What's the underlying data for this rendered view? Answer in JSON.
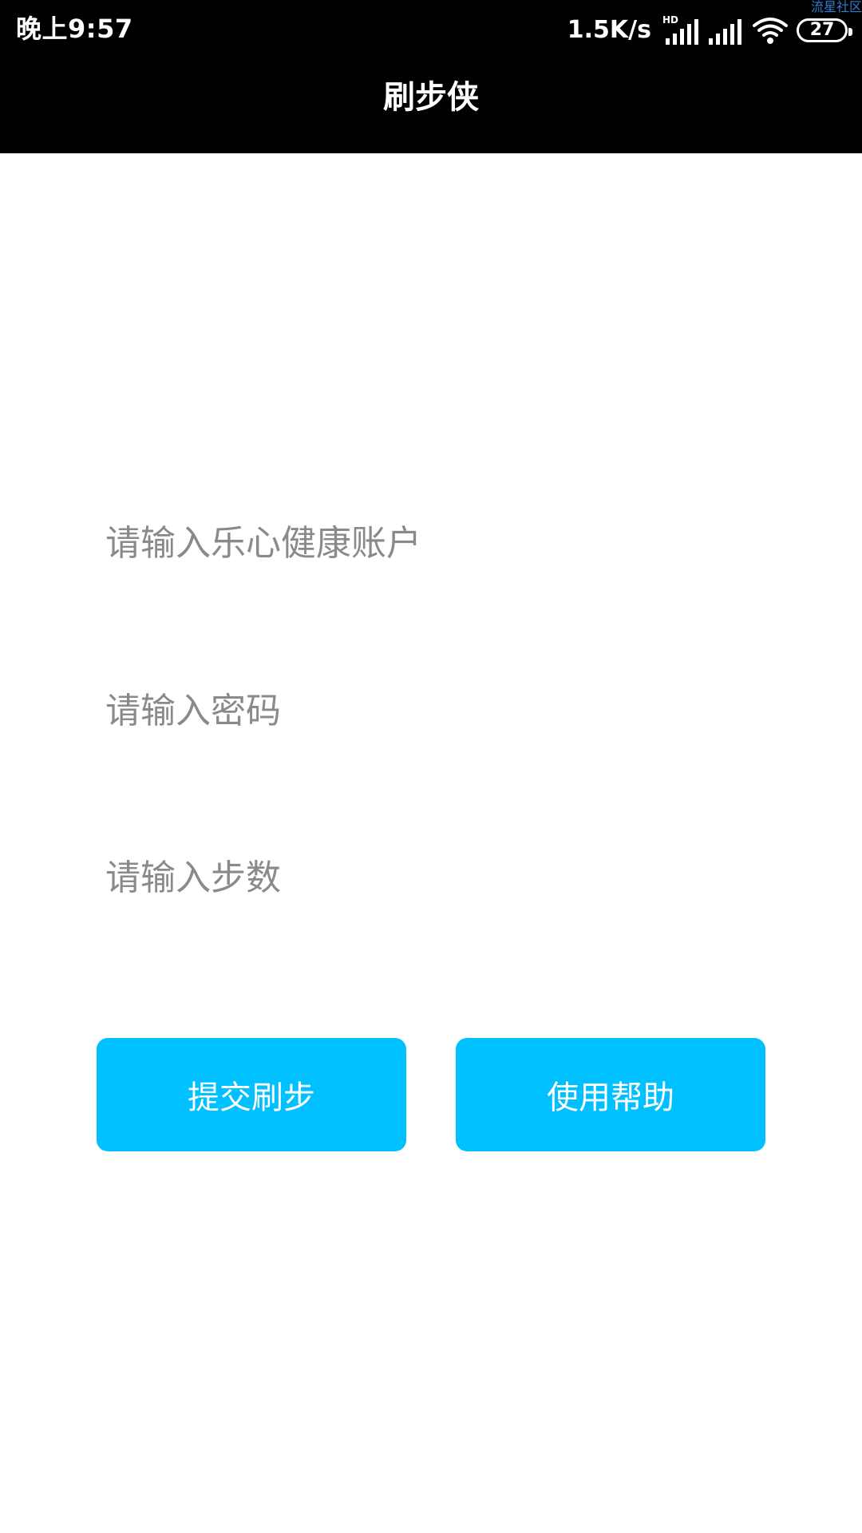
{
  "status_bar": {
    "time": "晚上9:57",
    "net_speed": "1.5K/s",
    "hd_label": "HD",
    "battery_level": "27",
    "watermark": "流星社区",
    "icons": [
      "hd-signal-icon",
      "cell-signal-icon",
      "wifi-icon",
      "battery-icon"
    ],
    "colors": {
      "background": "#000000",
      "text": "#ffffff",
      "watermark": "#2f7fd6"
    }
  },
  "app_bar": {
    "title": "刷步侠",
    "background": "#000000"
  },
  "form": {
    "account_placeholder": "请输入乐心健康账户",
    "password_placeholder": "请输入密码",
    "steps_placeholder": "请输入步数",
    "account_value": "",
    "password_value": "",
    "steps_value": ""
  },
  "actions": {
    "submit_label": "提交刷步",
    "help_label": "使用帮助",
    "button_color": "#00c0ff"
  }
}
